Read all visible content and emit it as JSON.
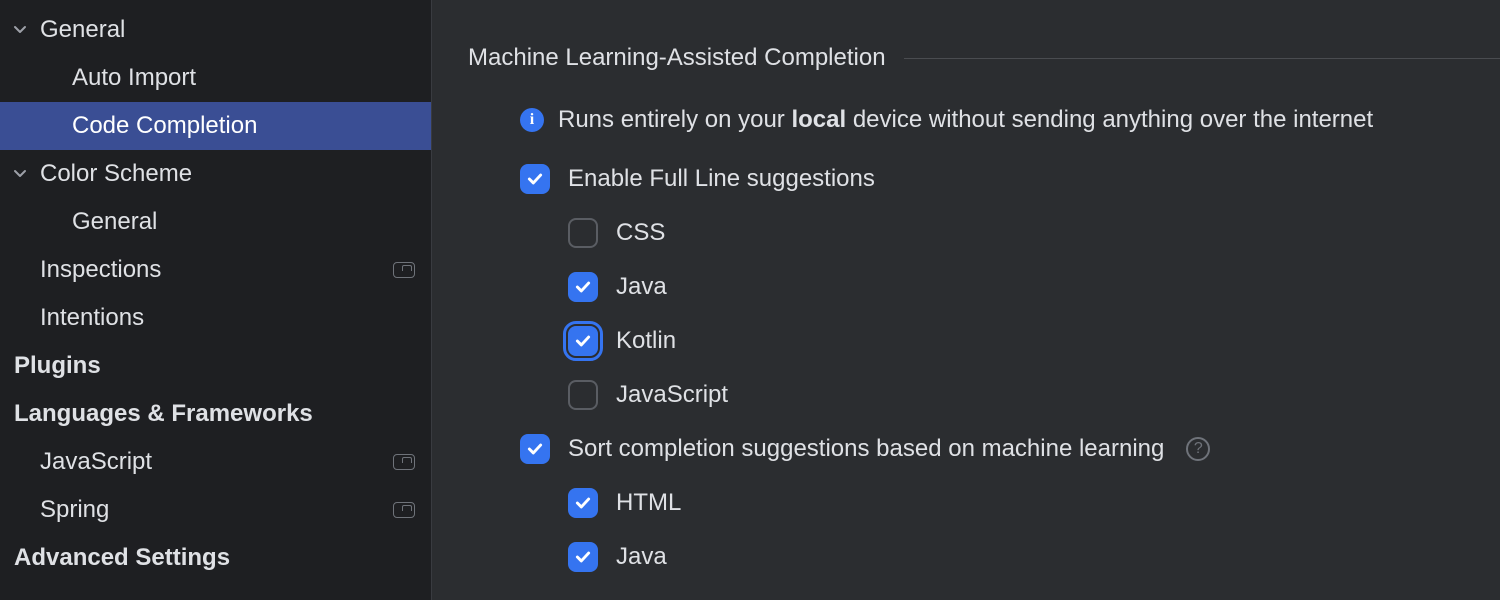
{
  "sidebar": {
    "items": [
      {
        "label": "General",
        "depth": 1,
        "expanded": true,
        "bold": false,
        "badge": false,
        "hasChildren": true,
        "selected": false
      },
      {
        "label": "Auto Import",
        "depth": 2,
        "bold": false,
        "badge": false,
        "hasChildren": false,
        "selected": false
      },
      {
        "label": "Code Completion",
        "depth": 2,
        "bold": false,
        "badge": false,
        "hasChildren": false,
        "selected": true
      },
      {
        "label": "Color Scheme",
        "depth": 1,
        "expanded": true,
        "bold": false,
        "badge": false,
        "hasChildren": true,
        "selected": false
      },
      {
        "label": "General",
        "depth": 2,
        "bold": false,
        "badge": false,
        "hasChildren": false,
        "selected": false
      },
      {
        "label": "Inspections",
        "depth": 1,
        "bold": false,
        "badge": true,
        "hasChildren": false,
        "selected": false
      },
      {
        "label": "Intentions",
        "depth": 1,
        "bold": false,
        "badge": false,
        "hasChildren": false,
        "selected": false
      },
      {
        "label": "Plugins",
        "depth": 0,
        "bold": true,
        "badge": false,
        "hasChildren": false,
        "selected": false
      },
      {
        "label": "Languages & Frameworks",
        "depth": 0,
        "bold": true,
        "badge": false,
        "hasChildren": false,
        "selected": false
      },
      {
        "label": "JavaScript",
        "depth": 1,
        "bold": false,
        "badge": true,
        "hasChildren": false,
        "selected": false
      },
      {
        "label": "Spring",
        "depth": 1,
        "bold": false,
        "badge": true,
        "hasChildren": false,
        "selected": false
      },
      {
        "label": "Advanced Settings",
        "depth": 0,
        "bold": true,
        "badge": false,
        "hasChildren": false,
        "selected": false
      }
    ]
  },
  "main": {
    "section_title": "Machine Learning-Assisted Completion",
    "info_prefix": "Runs entirely on your ",
    "info_bold": "local",
    "info_suffix": " device without sending anything over the internet",
    "enable_full_line": {
      "label": "Enable Full Line suggestions",
      "checked": true,
      "focused": false
    },
    "langs_full_line": [
      {
        "label": "CSS",
        "checked": false,
        "focused": false
      },
      {
        "label": "Java",
        "checked": true,
        "focused": false
      },
      {
        "label": "Kotlin",
        "checked": true,
        "focused": true
      },
      {
        "label": "JavaScript",
        "checked": false,
        "focused": false
      }
    ],
    "sort_ml": {
      "label": "Sort completion suggestions based on machine learning",
      "checked": true,
      "focused": false,
      "help": true
    },
    "langs_sort": [
      {
        "label": "HTML",
        "checked": true,
        "focused": false
      },
      {
        "label": "Java",
        "checked": true,
        "focused": false
      }
    ]
  }
}
